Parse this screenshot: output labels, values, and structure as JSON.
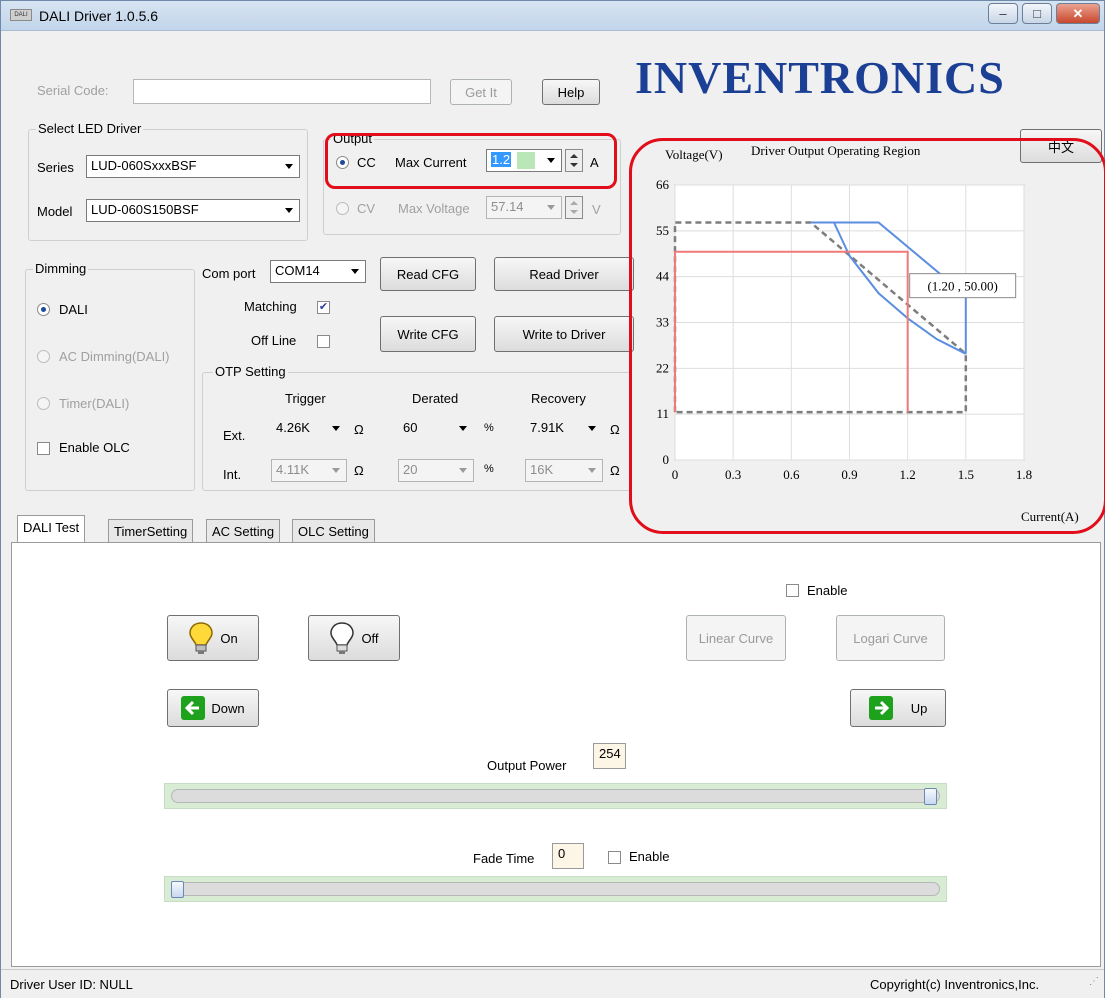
{
  "window": {
    "title": "DALI Driver 1.0.5.6",
    "app_icon_text": "DALI",
    "min": "–",
    "max": "□",
    "close": "✕"
  },
  "brand": {
    "logo_text": "INVENTRONICS",
    "logo_color": "#1b3f94"
  },
  "serial": {
    "label": "Serial Code:",
    "value": "",
    "get_label": "Get It",
    "help_label": "Help"
  },
  "lang_button": "中文",
  "select_driver": {
    "title": "Select LED Driver",
    "series_label": "Series",
    "series_value": "LUD-060SxxxBSF",
    "model_label": "Model",
    "model_value": "LUD-060S150BSF"
  },
  "output": {
    "title": "Output",
    "cc_label": "CC",
    "max_current_label": "Max Current",
    "max_current_value": "1.2",
    "cc_unit": "A",
    "cv_label": "CV",
    "max_voltage_label": "Max Voltage",
    "max_voltage_value": "57.14",
    "cv_unit": "V"
  },
  "dimming": {
    "title": "Dimming",
    "dali": "DALI",
    "ac_dimming": "AC Dimming(DALI)",
    "timer": "Timer(DALI)",
    "enable_olc": "Enable OLC"
  },
  "com": {
    "label": "Com port",
    "value": "COM14",
    "matching_label": "Matching",
    "offline_label": "Off Line",
    "read_cfg": "Read CFG",
    "read_driver": "Read Driver",
    "write_cfg": "Write CFG",
    "write_driver": "Write to Driver"
  },
  "otp": {
    "title": "OTP Setting",
    "trigger": "Trigger",
    "derated": "Derated",
    "recovery": "Recovery",
    "ext_label": "Ext.",
    "int_label": "Int.",
    "ext_trigger": "4.26K",
    "ext_derated": "60",
    "ext_recovery": "7.91K",
    "int_trigger": "4.11K",
    "int_derated": "20",
    "int_recovery": "16K",
    "ohm": "Ω",
    "pct": "%"
  },
  "chart_data": {
    "type": "line",
    "title": "Driver Output Operating Region",
    "xlabel": "Current(A)",
    "ylabel": "Voltage(V)",
    "xlim": [
      0,
      1.8
    ],
    "ylim": [
      0,
      66
    ],
    "x_ticks": [
      "0",
      "0.3",
      "0.6",
      "0.9",
      "1.2",
      "1.5",
      "1.8"
    ],
    "y_ticks": [
      "0",
      "11",
      "22",
      "33",
      "44",
      "55",
      "66"
    ],
    "grid": true,
    "series": [
      {
        "style": "dashed-gray",
        "points": [
          [
            0,
            11.5
          ],
          [
            0,
            57
          ],
          [
            0.7,
            57
          ],
          [
            1.5,
            25.5
          ],
          [
            1.5,
            11.5
          ],
          [
            0,
            11.5
          ]
        ]
      },
      {
        "style": "blue-outer",
        "points": [
          [
            0.7,
            57
          ],
          [
            1.05,
            57
          ],
          [
            1.5,
            39.5
          ],
          [
            1.5,
            25.5
          ]
        ]
      },
      {
        "style": "blue-curve",
        "points": [
          [
            0.82,
            57
          ],
          [
            0.9,
            49
          ],
          [
            1.05,
            40
          ],
          [
            1.2,
            34
          ],
          [
            1.35,
            29
          ],
          [
            1.5,
            25.5
          ]
        ]
      },
      {
        "style": "red-rect",
        "points": [
          [
            0,
            11.5
          ],
          [
            0,
            50
          ],
          [
            1.2,
            50
          ],
          [
            1.2,
            11.5
          ]
        ]
      }
    ],
    "tooltip": {
      "text": "(1.20 , 50.00)",
      "x": 1.2,
      "y": 50
    },
    "colors": {
      "blue": "#5b8ee0",
      "red": "#f07a78",
      "gray": "#7d7d7d"
    }
  },
  "tabs": [
    {
      "label": "DALI Test"
    },
    {
      "label": "TimerSetting"
    },
    {
      "label": "AC Setting"
    },
    {
      "label": "OLC Setting"
    }
  ],
  "dali_test": {
    "on_label": "On",
    "off_label": "Off",
    "enable_label": "Enable",
    "linear_curve": "Linear Curve",
    "logari_curve": "Logari Curve",
    "down_label": "Down",
    "up_label": "Up",
    "output_power_label": "Output Power",
    "output_power_value": "254",
    "output_power_fraction": 0.996,
    "fade_time_label": "Fade Time",
    "fade_time_value": "0",
    "fade_time_fraction": 0.0,
    "fade_enable_label": "Enable"
  },
  "status": {
    "user_id": "Driver User ID: NULL",
    "copyright": "Copyright(c) Inventronics,Inc."
  }
}
